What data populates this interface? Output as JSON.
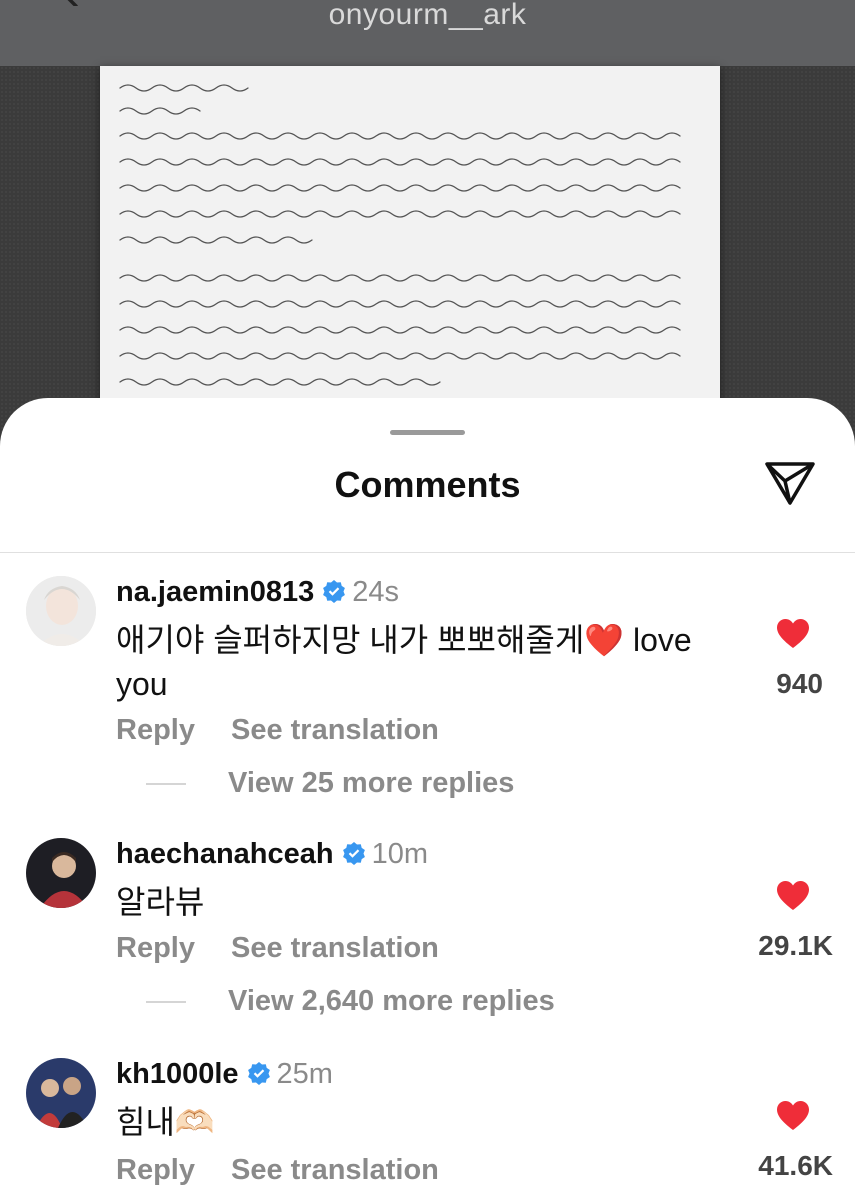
{
  "header": {
    "account": "onyourm__ark",
    "back_icon": "back-arrow-icon"
  },
  "post_image": {
    "subject": "handwritten-letter"
  },
  "sheet": {
    "title": "Comments",
    "share_icon": "send-icon"
  },
  "comments": [
    {
      "username": "na.jaemin0813",
      "verified": true,
      "time": "24s",
      "text": "애기야 슬퍼하지망 내가 뽀뽀해줄게❤️ love you",
      "reply_label": "Reply",
      "translate_label": "See translation",
      "likes": "940",
      "view_replies": "View 25 more replies"
    },
    {
      "username": "haechanahceah",
      "verified": true,
      "time": "10m",
      "text": "알라뷰",
      "reply_label": "Reply",
      "translate_label": "See translation",
      "likes": "29.1K",
      "view_replies": "View 2,640 more replies"
    },
    {
      "username": "kh1000le",
      "verified": true,
      "time": "25m",
      "text": "힘내🫶🏻",
      "reply_label": "Reply",
      "translate_label": "See translation",
      "likes": "41.6K"
    }
  ],
  "colors": {
    "heart": "#ef2d39",
    "verified": "#3897f0",
    "muted": "#8a8a8a"
  }
}
